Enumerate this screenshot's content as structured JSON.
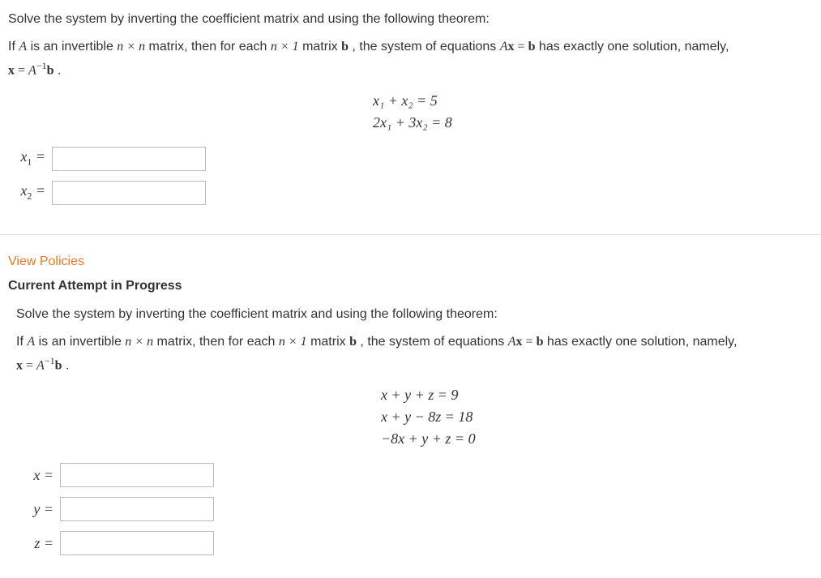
{
  "problem1": {
    "prompt": "Solve the system by inverting the coefficient matrix and using the following theorem:",
    "theorem_prefix": "If ",
    "theorem_A": "A",
    "theorem_mid1": " is an invertible ",
    "theorem_nxn": "n × n",
    "theorem_mid2": " matrix, then for each ",
    "theorem_nx1": "n × 1",
    "theorem_mid3": " matrix ",
    "theorem_b": "b",
    "theorem_mid4": " , the system of equations ",
    "theorem_Ax": "A",
    "theorem_xvec": "x",
    "theorem_eq": " = ",
    "theorem_b2": "b",
    "theorem_mid5": " has exactly one solution, namely,",
    "theorem_solution_x": "x",
    "theorem_solution_eq": " = ",
    "theorem_solution_A": "A",
    "theorem_solution_exp": "−1",
    "theorem_solution_b": "b",
    "theorem_solution_dot": " .",
    "eq1": "x₁ + x₂ = 5",
    "eq2": "2x₁ + 3x₂ = 8",
    "answers": {
      "x1_label": "x",
      "x1_sub": "1",
      "x1_eq": " =",
      "x2_label": "x",
      "x2_sub": "2",
      "x2_eq": " ="
    }
  },
  "links": {
    "view_policies": "View Policies"
  },
  "attempt_title": "Current Attempt in Progress",
  "problem2": {
    "prompt": "Solve the system by inverting the coefficient matrix and using the following theorem:",
    "theorem_prefix": "If ",
    "theorem_A": "A",
    "theorem_mid1": " is an invertible ",
    "theorem_nxn": "n × n",
    "theorem_mid2": " matrix, then for each ",
    "theorem_nx1": "n × 1",
    "theorem_mid3": " matrix ",
    "theorem_b": "b",
    "theorem_mid4": " , the system of equations ",
    "theorem_Ax": "A",
    "theorem_xvec": "x",
    "theorem_eq": " = ",
    "theorem_b2": "b",
    "theorem_mid5": " has exactly one solution, namely,",
    "theorem_solution_x": "x",
    "theorem_solution_eq": " = ",
    "theorem_solution_A": "A",
    "theorem_solution_exp": "−1",
    "theorem_solution_b": "b",
    "theorem_solution_dot": " .",
    "eq1": "x + y + z = 9",
    "eq2": "x + y − 8z = 18",
    "eq3": "−8x + y + z = 0",
    "answers": {
      "x_label": "x =",
      "y_label": "y =",
      "z_label": "z ="
    }
  }
}
